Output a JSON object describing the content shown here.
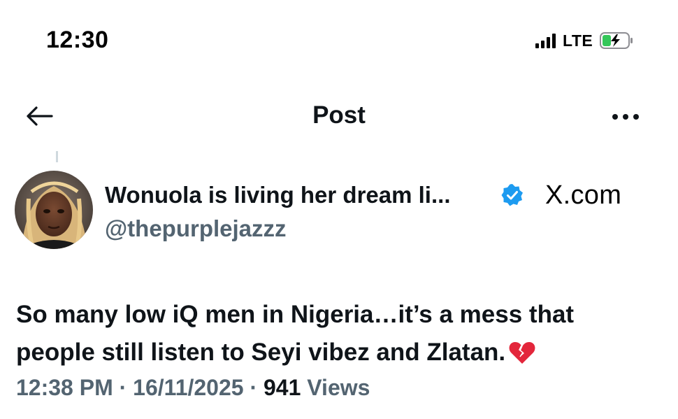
{
  "status_bar": {
    "time": "12:30",
    "network": "LTE"
  },
  "nav": {
    "title": "Post"
  },
  "author": {
    "display_name": "Wonuola is living her dream li...",
    "handle": "@thepurplejazzz",
    "verified": true
  },
  "watermark": {
    "text": "X.com"
  },
  "post": {
    "text_line1": "So many low iQ men in Nigeria…it’s a mess that",
    "text_line2": "people still listen to Seyi vibez and Zlatan.",
    "emoji": "broken-heart-icon",
    "time": "12:38 PM",
    "separator": "·",
    "date": "16/11/2025",
    "views_count": "941",
    "views_label": "Views"
  },
  "colors": {
    "text_primary": "#0f1419",
    "text_secondary": "#536471",
    "verified_blue": "#1d9bf0",
    "battery_green": "#34c759",
    "heart_red": "#e3263b"
  }
}
